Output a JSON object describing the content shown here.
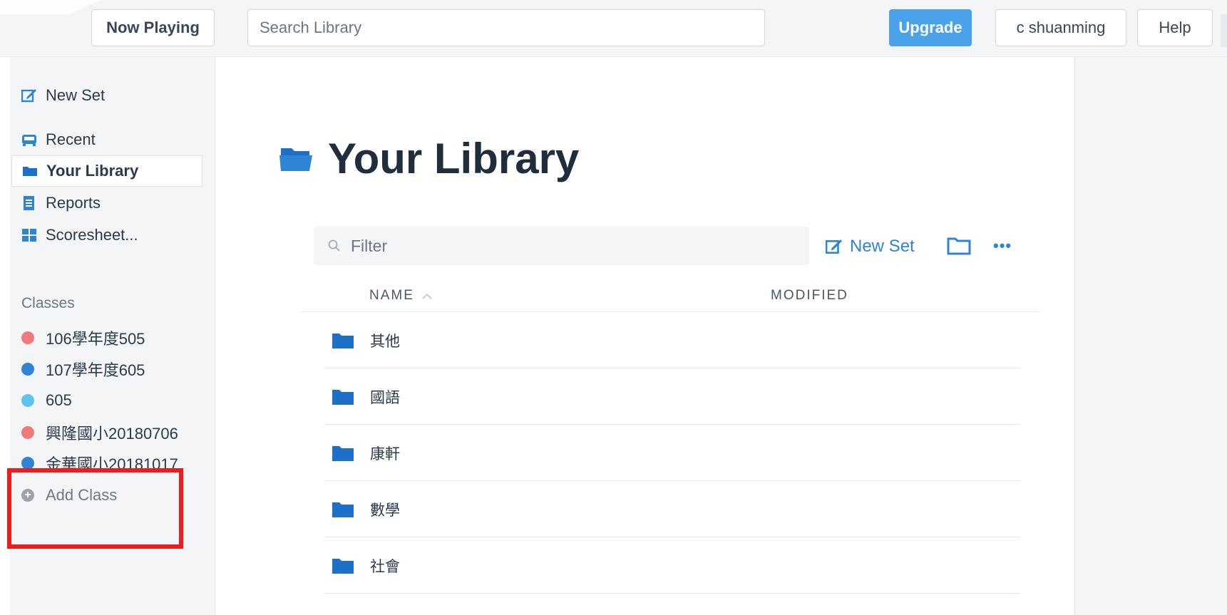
{
  "topbar": {
    "now_playing": "Now Playing",
    "search_placeholder": "Search Library",
    "upgrade": "Upgrade",
    "user": "c shuanming",
    "help": "Help"
  },
  "sidebar": {
    "items": [
      {
        "label": "New Set",
        "icon": "edit-icon"
      },
      {
        "label": "Recent",
        "icon": "recent-icon"
      },
      {
        "label": "Your Library",
        "icon": "folder-icon",
        "active": true
      },
      {
        "label": "Reports",
        "icon": "reports-icon"
      },
      {
        "label": "Scoresheet...",
        "icon": "grid-icon"
      }
    ],
    "classes_heading": "Classes",
    "classes": [
      {
        "label": "106學年度505",
        "color": "#ef7a7a"
      },
      {
        "label": "107學年度605",
        "color": "#2f84d6"
      },
      {
        "label": "605",
        "color": "#5ec3f2"
      },
      {
        "label": "興隆國小20180706",
        "color": "#ef7a7a"
      },
      {
        "label": "金華國小20181017",
        "color": "#2f84d6"
      }
    ],
    "add_class": "Add Class"
  },
  "main": {
    "title": "Your Library",
    "filter_placeholder": "Filter",
    "new_set": "New Set",
    "more": "•••",
    "columns": {
      "name": "NAME",
      "modified": "MODIFIED"
    },
    "folders": [
      "其他",
      "國語",
      "康軒",
      "數學",
      "社會"
    ]
  },
  "colors": {
    "accent": "#2f84d6",
    "upgrade": "#4aa3ea",
    "highlight_box": "#ee1c1c"
  }
}
